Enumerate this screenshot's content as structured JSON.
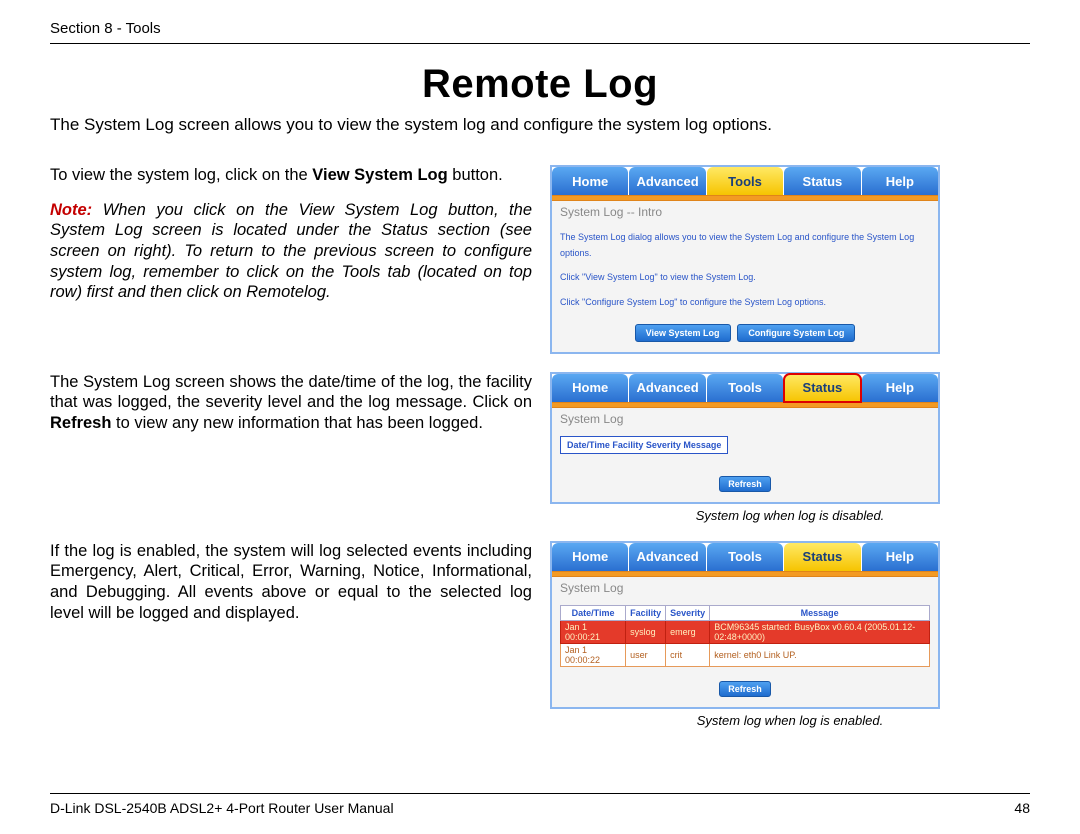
{
  "header": {
    "section": "Section 8 - Tools"
  },
  "title": "Remote Log",
  "intro": "The System Log screen allows you to view the system log and configure the system log options.",
  "para1a": "To view the system log, click on the ",
  "para1b": "View System Log",
  "para1c": " button.",
  "note_label": "Note:",
  "note_text": " When you click on the View System Log button, the System Log screen is located under the Status section (see screen on right). To return to the previous screen to configure system log, remember to click on the Tools tab (located on top row) first and then click on Remotelog.",
  "para2a": "The System Log screen shows the date/time of the log, the facility that was logged, the severity level and the log message. Click on ",
  "para2b": "Refresh",
  "para2c": " to view any new information that has been logged.",
  "caption_disabled": "System log when log is disabled.",
  "para3": "If the log is enabled, the system will log selected events including Emergency, Alert, Critical, Error, Warning, Notice, Informational, and Debugging.  All events above or equal to the selected log level will be logged and displayed.",
  "caption_enabled": "System log when log is enabled.",
  "tabs": {
    "home": "Home",
    "advanced": "Advanced",
    "tools": "Tools",
    "status": "Status",
    "help": "Help"
  },
  "panel1": {
    "title": "System Log -- Intro",
    "line1": "The System Log dialog allows you to view the System Log and configure the System Log options.",
    "line2": "Click \"View System Log\" to view the System Log.",
    "line3": "Click \"Configure System Log\" to configure the System Log options.",
    "btn_view": "View System Log",
    "btn_conf": "Configure System Log"
  },
  "panel2": {
    "title": "System Log",
    "header_text": "Date/Time Facility Severity Message",
    "btn_refresh": "Refresh"
  },
  "panel3": {
    "title": "System Log",
    "cols": {
      "dt": "Date/Time",
      "fac": "Facility",
      "sev": "Severity",
      "msg": "Message"
    },
    "rows": [
      {
        "dt": "Jan 1 00:00:21",
        "fac": "syslog",
        "sev": "emerg",
        "msg": "BCM96345 started: BusyBox v0.60.4 (2005.01.12-02:48+0000)"
      },
      {
        "dt": "Jan 1 00:00:22",
        "fac": "user",
        "sev": "crit",
        "msg": "kernel: eth0 Link UP."
      }
    ],
    "btn_refresh": "Refresh"
  },
  "footer": {
    "left": "D-Link DSL-2540B ADSL2+ 4-Port Router User Manual",
    "right": "48"
  }
}
